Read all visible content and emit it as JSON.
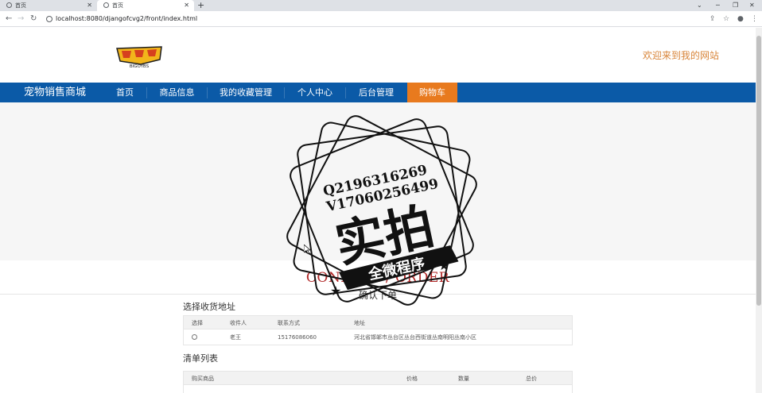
{
  "browser": {
    "tabs": [
      {
        "title": "首页",
        "active": false
      },
      {
        "title": "首页",
        "active": true
      }
    ],
    "new_tab": "+",
    "url": "localhost:8080/djangofcvg2/front/index.html"
  },
  "header": {
    "logo_text": "BIGOYBS",
    "welcome": "欢迎来到我的网站"
  },
  "nav": {
    "brand": "宠物销售商城",
    "items": [
      {
        "label": "首页",
        "active": false
      },
      {
        "label": "商品信息",
        "active": false
      },
      {
        "label": "我的收藏管理",
        "active": false
      },
      {
        "label": "个人中心",
        "active": false
      },
      {
        "label": "后台管理",
        "active": false
      },
      {
        "label": "购物车",
        "active": true
      }
    ]
  },
  "watermark": {
    "line1": "Q2196316269",
    "line2": "V17060256499",
    "big": "实拍",
    "ribbon": "全微程序"
  },
  "order": {
    "ghost_title": "CONFIRM / ORDER",
    "title": "确认下单"
  },
  "address_section": {
    "title": "选择收货地址",
    "columns": [
      "选择",
      "收件人",
      "联系方式",
      "地址"
    ],
    "rows": [
      {
        "recipient": "老王",
        "phone": "15176086060",
        "address": "河北省邯郸市丛台区丛台西街道丛南明阳丛南小区"
      }
    ]
  },
  "items_section": {
    "title": "清单列表",
    "columns": [
      "购买商品",
      "价格",
      "数量",
      "总价"
    ]
  },
  "colors": {
    "nav_bg": "#0b5aa7",
    "nav_active": "#e87a1e",
    "welcome": "#d8853a",
    "ghost_title": "#b02525"
  }
}
